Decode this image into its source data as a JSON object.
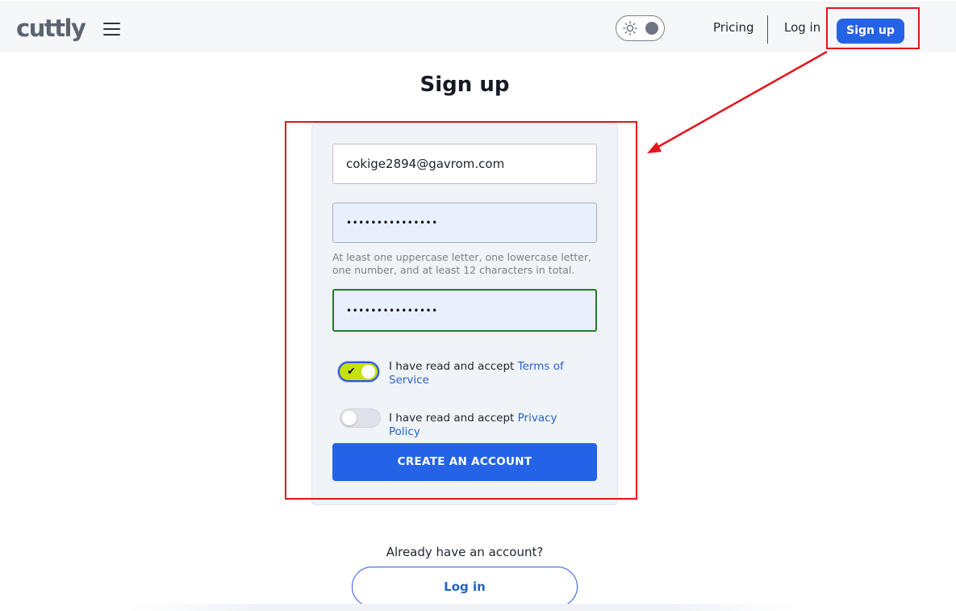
{
  "header": {
    "logo": "cuttly",
    "nav": {
      "pricing": "Pricing",
      "login": "Log in",
      "signup": "Sign up"
    }
  },
  "icons": {
    "menu": "hamburger-menu-icon",
    "theme_light": "sun-icon",
    "terms_toggle_check": "check-icon"
  },
  "page": {
    "title": "Sign up"
  },
  "form": {
    "email_value": "cokige2894@gavrom.com",
    "password_value": "•••••••••••••••",
    "password_hint": "At least one uppercase letter, one lowercase letter, one number, and at least 12 characters in total.",
    "confirm_password_value": "•••••••••••••••",
    "terms": {
      "text": "I have read and accept ",
      "link": "Terms of Service",
      "checked": true
    },
    "privacy": {
      "text": "I have read and accept ",
      "link": "Privacy Policy",
      "checked": false
    },
    "submit_label": "CREATE AN ACCOUNT"
  },
  "footer": {
    "already_text": "Already have an account?",
    "login_label": "Log in"
  },
  "colors": {
    "primary": "#2563e6",
    "toggle_on": "#c5e20e",
    "valid_border": "#237a2b",
    "annotation_red": "#e5131b"
  }
}
